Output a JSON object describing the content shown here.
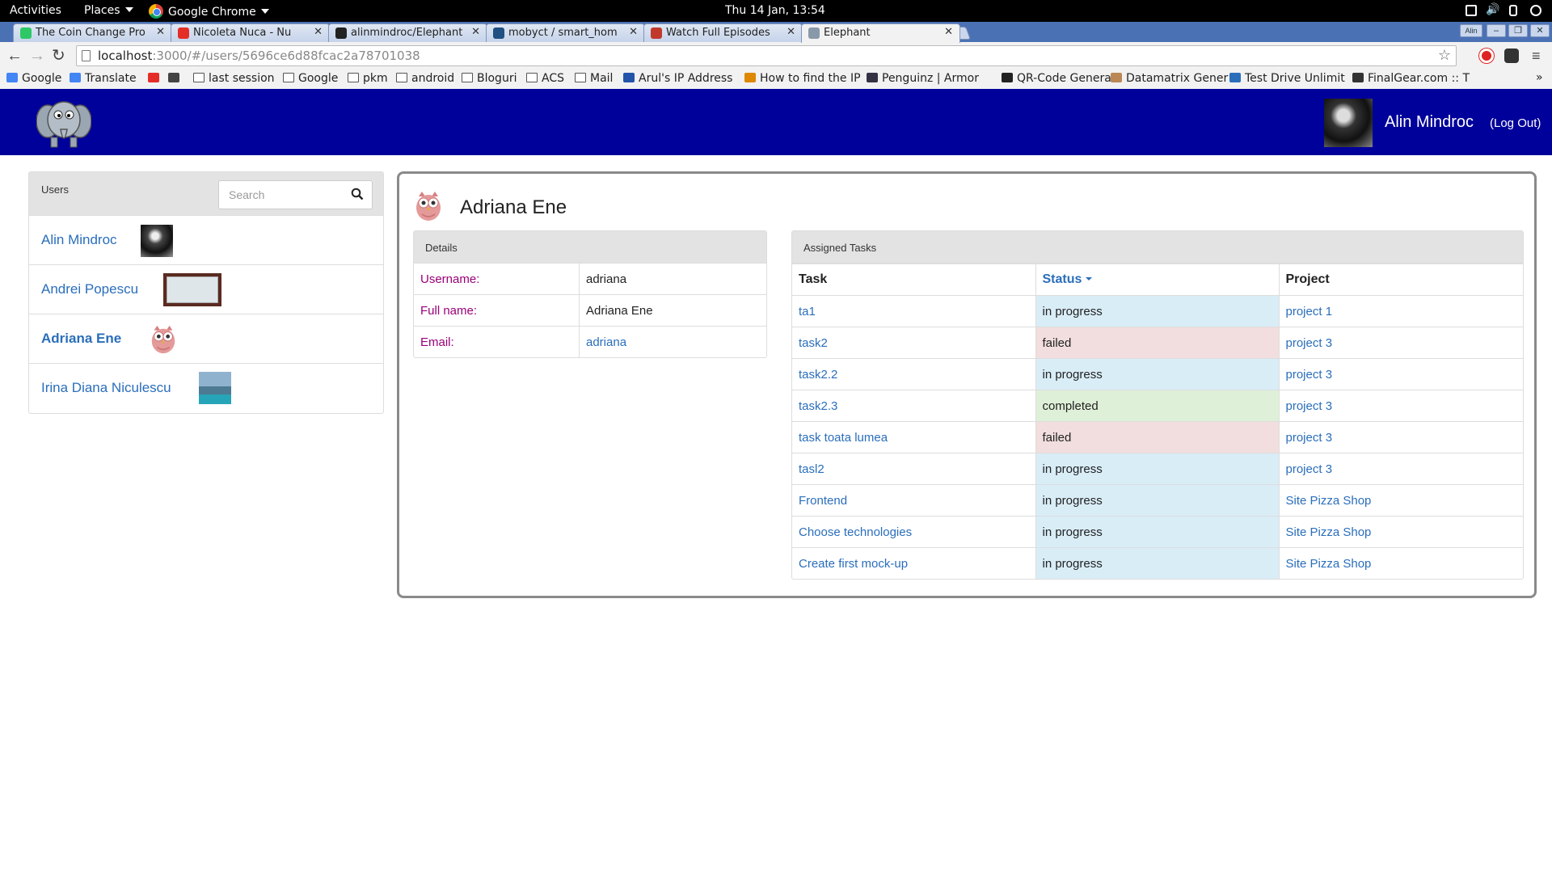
{
  "os_bar": {
    "activities": "Activities",
    "places": "Places",
    "app": "Google Chrome",
    "clock": "Thu 14 Jan, 13:54"
  },
  "tabs": [
    {
      "title": "The Coin Change Pro",
      "favicon": "hackerrank-icon",
      "color": "#2ec866"
    },
    {
      "title": "Nicoleta Nuca - Nu",
      "favicon": "youtube-icon",
      "color": "#e52d27"
    },
    {
      "title": "alinmindroc/Elephant",
      "favicon": "github-icon",
      "color": "#222222"
    },
    {
      "title": "mobyct / smart_hom",
      "favicon": "bitbucket-icon",
      "color": "#205081"
    },
    {
      "title": "Watch Full Episodes",
      "favicon": "watch-icon",
      "color": "#c0392b"
    },
    {
      "title": "Elephant",
      "favicon": "elephant-icon",
      "color": "#8899aa",
      "active": true
    }
  ],
  "window_badge": "Alin",
  "address": {
    "host": "localhost",
    "rest": ":3000/#/users/5696ce6d88fcac2a78701038"
  },
  "bookmarks": [
    {
      "label": "Google",
      "icon": "google-icon"
    },
    {
      "label": "Translate",
      "icon": "translate-icon"
    },
    {
      "label": "",
      "icon": "youtube-icon"
    },
    {
      "label": "",
      "icon": "dict-icon"
    },
    {
      "label": "last session",
      "icon": "folder-icon"
    },
    {
      "label": "Google",
      "icon": "folder-icon"
    },
    {
      "label": "pkm",
      "icon": "folder-icon"
    },
    {
      "label": "android",
      "icon": "folder-icon"
    },
    {
      "label": "Bloguri",
      "icon": "folder-icon"
    },
    {
      "label": "ACS",
      "icon": "folder-icon"
    },
    {
      "label": "Mail",
      "icon": "folder-icon"
    },
    {
      "label": "Arul's IP Address",
      "icon": "ip-icon"
    },
    {
      "label": "How to find the IP",
      "icon": "page-icon"
    },
    {
      "label": "Penguinz | Armor",
      "icon": "shield-icon"
    },
    {
      "label": "QR-Code Generat",
      "icon": "qr-icon"
    },
    {
      "label": "Datamatrix Gener",
      "icon": "k-icon"
    },
    {
      "label": "Test Drive Unlimit",
      "icon": "g-icon"
    },
    {
      "label": "FinalGear.com :: T",
      "icon": "fg-icon"
    }
  ],
  "navbar": {
    "user_name": "Alin Mindroc",
    "logout": "(Log Out)",
    "brand_color": "#00009b"
  },
  "users_panel": {
    "title": "Users",
    "search_placeholder": "Search",
    "users": [
      {
        "name": "Alin Mindroc",
        "avatar": "person-dark-avatar",
        "active": false
      },
      {
        "name": "Andrei Popescu",
        "avatar": "whiteboard-avatar",
        "active": false
      },
      {
        "name": "Adriana Ene",
        "avatar": "owl-avatar",
        "active": true
      },
      {
        "name": "Irina Diana Niculescu",
        "avatar": "seaside-avatar",
        "active": false
      }
    ]
  },
  "profile": {
    "name": "Adriana Ene",
    "details_title": "Details",
    "details": [
      {
        "label": "Username:",
        "value": "adriana",
        "link": false
      },
      {
        "label": "Full name:",
        "value": "Adriana Ene",
        "link": false
      },
      {
        "label": "Email:",
        "value": "adriana",
        "link": true
      }
    ]
  },
  "tasks": {
    "title": "Assigned Tasks",
    "columns": [
      "Task",
      "Status",
      "Project"
    ],
    "sorted_column": "Status",
    "rows": [
      {
        "task": "ta1",
        "status": "in progress",
        "project": "project 1"
      },
      {
        "task": "task2",
        "status": "failed",
        "project": "project 3"
      },
      {
        "task": "task2.2",
        "status": "in progress",
        "project": "project 3"
      },
      {
        "task": "task2.3",
        "status": "completed",
        "project": "project 3"
      },
      {
        "task": "task toata lumea",
        "status": "failed",
        "project": "project 3"
      },
      {
        "task": "tasl2",
        "status": "in progress",
        "project": "project 3"
      },
      {
        "task": "Frontend",
        "status": "in progress",
        "project": "Site Pizza Shop"
      },
      {
        "task": "Choose technologies",
        "status": "in progress",
        "project": "Site Pizza Shop"
      },
      {
        "task": "Create first mock-up",
        "status": "in progress",
        "project": "Site Pizza Shop"
      }
    ],
    "status_colors": {
      "in progress": "#d9edf7",
      "failed": "#f2dede",
      "completed": "#dff0d8"
    }
  }
}
